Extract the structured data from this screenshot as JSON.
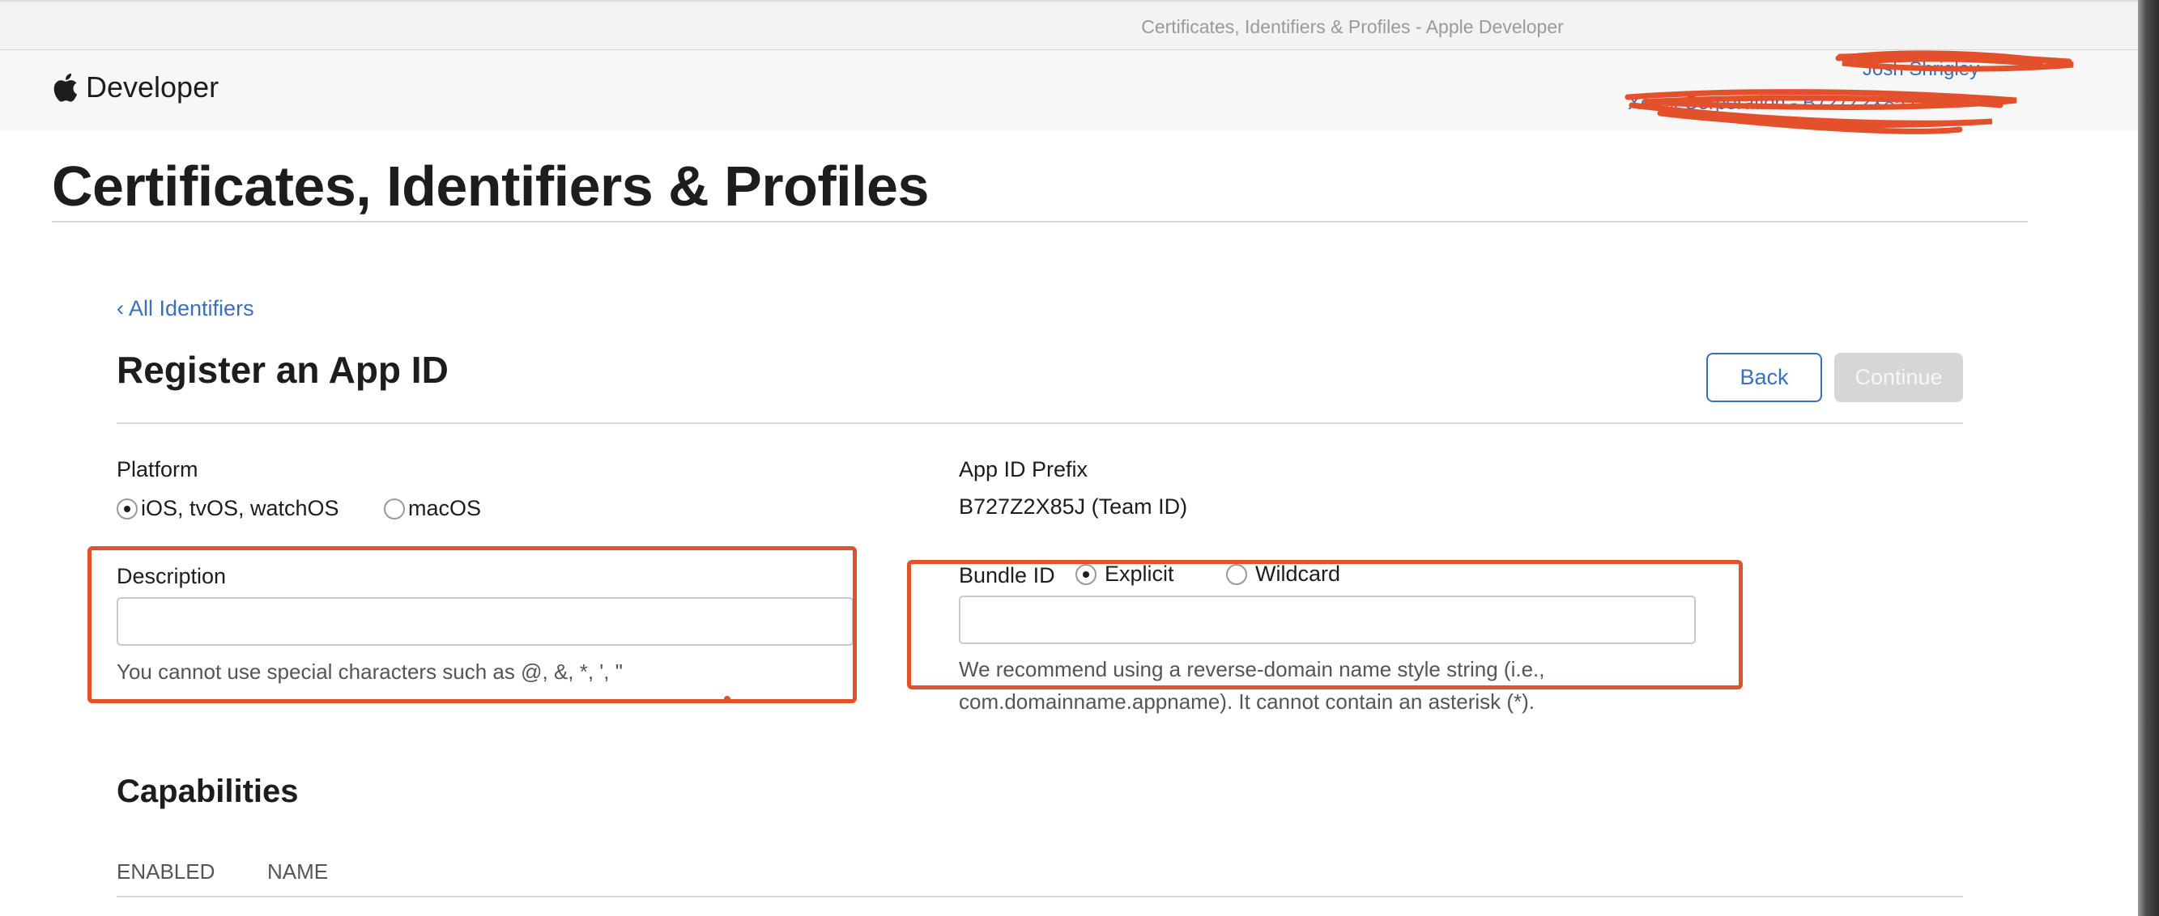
{
  "window": {
    "title": "Certificates, Identifiers & Profiles - Apple Developer"
  },
  "header": {
    "brand": "Developer",
    "account_name": "Josh Shrigley",
    "account_team": "Xerox Corporation - B727Z2X85J"
  },
  "page": {
    "title": "Certificates, Identifiers & Profiles"
  },
  "form": {
    "back_link": "‹ All Identifiers",
    "heading": "Register an App ID",
    "back_button": "Back",
    "continue_button": "Continue",
    "platform": {
      "label": "Platform",
      "options": [
        "iOS, tvOS, watchOS",
        "macOS"
      ],
      "selected": "iOS, tvOS, watchOS"
    },
    "app_id_prefix": {
      "label": "App ID Prefix",
      "value": "B727Z2X85J (Team ID)"
    },
    "description": {
      "label": "Description",
      "value": "",
      "placeholder": "",
      "help": "You cannot use special characters such as @, &, *, ', \""
    },
    "bundle_id": {
      "label": "Bundle ID",
      "options": [
        "Explicit",
        "Wildcard"
      ],
      "selected": "Explicit",
      "value": "",
      "placeholder": "",
      "help_line1": "We recommend using a reverse-domain name style string (i.e.,",
      "help_line2": "com.domainname.appname). It cannot contain an asterisk (*)."
    }
  },
  "capabilities": {
    "heading": "Capabilities",
    "columns": [
      "ENABLED",
      "NAME"
    ]
  },
  "colors": {
    "link": "#3a6fb9",
    "annotation": "#e2502c",
    "disabled_button": "#d6d6d6"
  }
}
